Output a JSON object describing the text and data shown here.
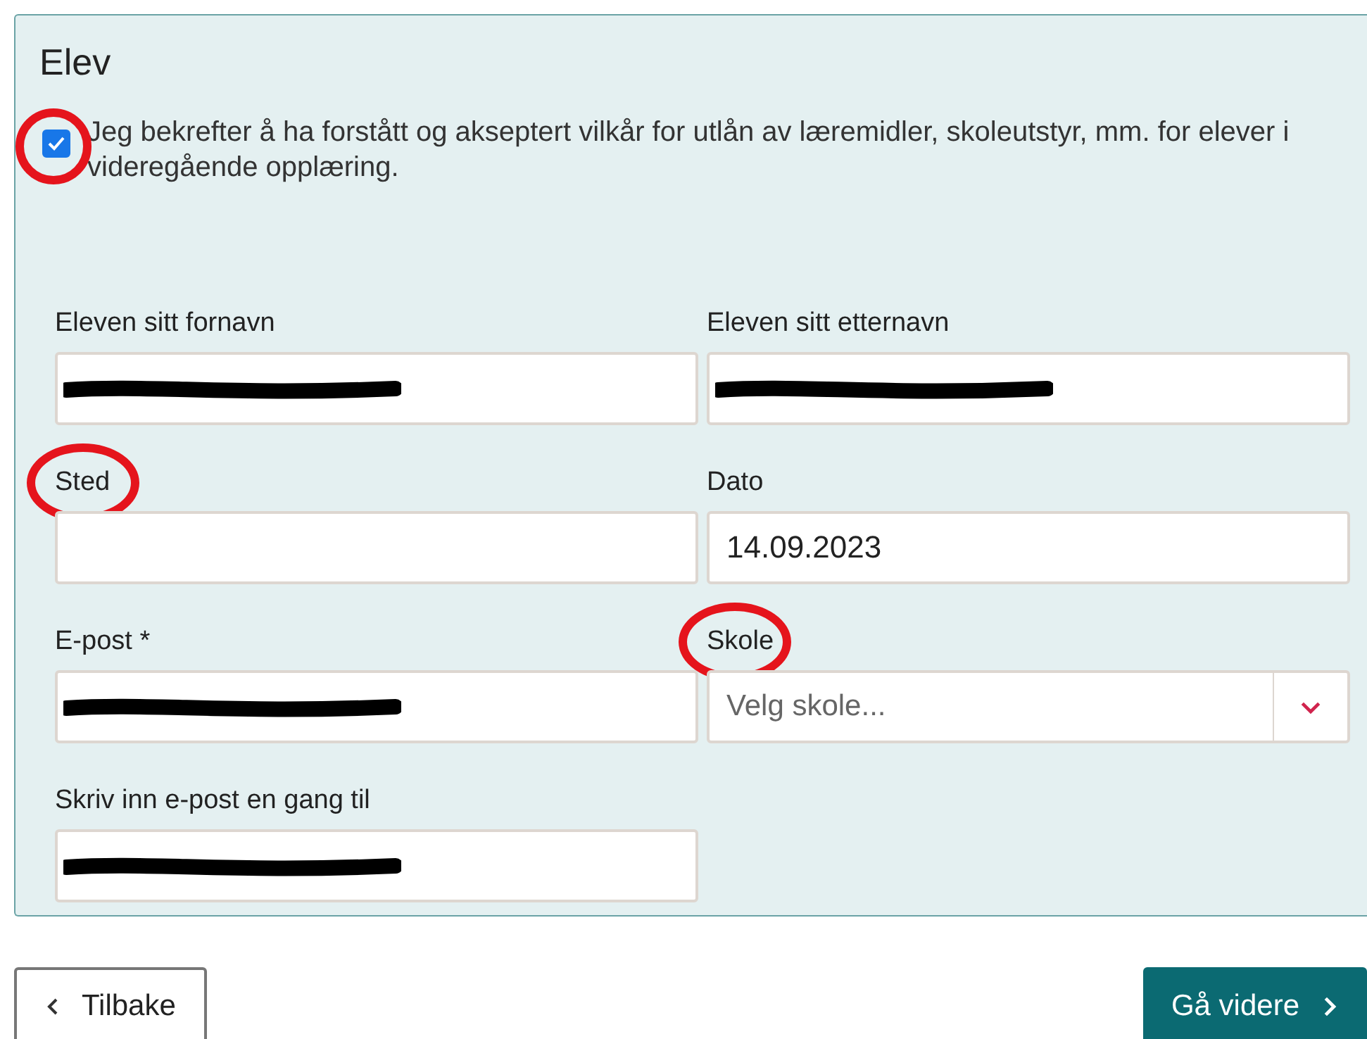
{
  "panel": {
    "title": "Elev"
  },
  "consent": {
    "label": "Jeg bekrefter å ha forstått og akseptert vilkår for utlån av læremidler, skoleutstyr, mm. for elever i videregående opplæring.",
    "checked": true,
    "annotated": true
  },
  "fields": [
    {
      "kind": "text",
      "label": "Eleven sitt fornavn",
      "redacted": true,
      "annotated": false
    },
    {
      "kind": "text",
      "label": "Eleven sitt etternavn",
      "redacted": true,
      "annotated": false
    },
    {
      "kind": "text",
      "label": "Sted",
      "redacted": false,
      "annotated": true
    },
    {
      "kind": "text",
      "label": "Dato",
      "value": "14.09.2023",
      "redacted": false,
      "annotated": false
    },
    {
      "kind": "text",
      "label": "E-post *",
      "redacted": true,
      "annotated": false
    },
    {
      "kind": "select",
      "label": "Skole",
      "placeholder": "Velg skole...",
      "annotated": true
    },
    {
      "kind": "text",
      "label": "Skriv inn e-post en gang til",
      "redacted": true,
      "annotated": false
    }
  ],
  "buttons": [
    {
      "kind": "back",
      "label": "Tilbake"
    },
    {
      "kind": "next",
      "label": "Gå videre"
    }
  ]
}
